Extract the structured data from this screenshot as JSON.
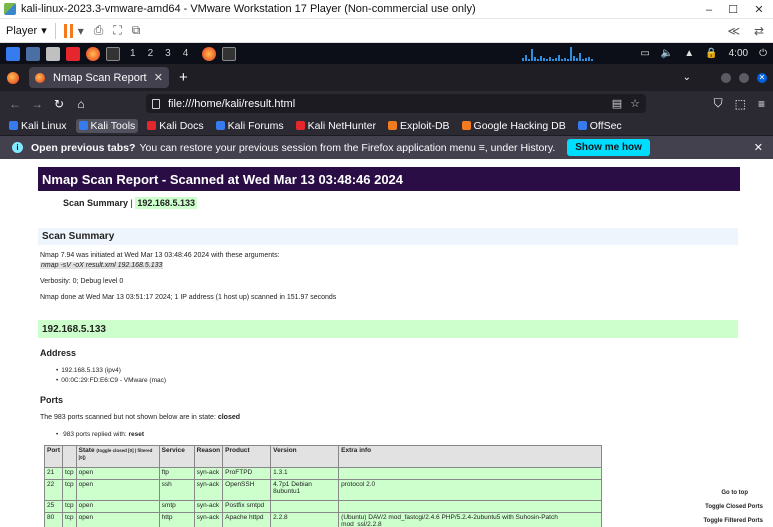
{
  "vmware": {
    "title": "kali-linux-2023.3-vmware-amd64 - VMware Workstation 17 Player (Non-commercial use only)",
    "minimize": "–",
    "maximize": "☐",
    "close": "✕",
    "player_menu": "Player",
    "right_icons": [
      "≪",
      "⇄"
    ]
  },
  "kali_panel": {
    "workspaces": [
      "1",
      "2",
      "3",
      "4"
    ],
    "clock": "4:00"
  },
  "firefox": {
    "tab_title": "Nmap Scan Report - Scanned",
    "tab_close": "✕",
    "new_tab": "+",
    "url": "file:///home/kali/result.html",
    "bookmarks": [
      "Kali Linux",
      "Kali Tools",
      "Kali Docs",
      "Kali Forums",
      "Kali NetHunter",
      "Exploit-DB",
      "Google Hacking DB",
      "OffSec"
    ],
    "bookmark_colors": [
      "#367bf0",
      "#367bf0",
      "#e5272d",
      "#367bf0",
      "#e5272d",
      "#f27b1f",
      "#f27b1f",
      "#367bf0"
    ],
    "notification": {
      "bold": "Open previous tabs?",
      "text": "You can restore your previous session from the Firefox application menu ≡, under History.",
      "button": "Show me how",
      "close": "✕"
    }
  },
  "report": {
    "title": "Nmap Scan Report - Scanned at Wed Mar 13 03:48:46 2024",
    "scan_summary_label": "Scan Summary",
    "scan_summary_sep": "|",
    "scan_summary_ip": "192.168.5.133",
    "section_scan_summary": "Scan Summary",
    "initiated": "Nmap 7.94 was initiated at Wed Mar 13 03:48:46 2024 with these arguments:",
    "command": "nmap -sV -oX result.xml 192.168.5.133",
    "verbosity": "Verbosity: 0; Debug level 0",
    "done": "Nmap done at Wed Mar 13 03:51:17 2024; 1 IP address (1 host up) scanned in 151.97 seconds",
    "host": "192.168.5.133",
    "address_hdr": "Address",
    "addresses": [
      "192.168.5.133 (ipv4)",
      "00:0C:29:FD:E6:C9 - VMware (mac)"
    ],
    "ports_hdr": "Ports",
    "ports_note_prefix": "The 983 ports scanned but not shown below are in state:",
    "ports_note_state": "closed",
    "ports_bullet_prefix": "983 ports replied with:",
    "ports_bullet_reason": "reset",
    "table": {
      "headers": [
        "Port",
        "",
        "State",
        "Service",
        "Reason",
        "Product",
        "Version",
        "Extra info"
      ],
      "state_note": "(toggle closed [0] | filtered [0])",
      "rows": [
        [
          "21",
          "tcp",
          "open",
          "ftp",
          "syn-ack",
          "ProFTPD",
          "1.3.1",
          ""
        ],
        [
          "22",
          "tcp",
          "open",
          "ssh",
          "syn-ack",
          "OpenSSH",
          "4.7p1 Debian 8ubuntu1",
          "protocol 2.0"
        ],
        [
          "25",
          "tcp",
          "open",
          "smtp",
          "syn-ack",
          "Postfix smtpd",
          "",
          ""
        ],
        [
          "80",
          "tcp",
          "open",
          "http",
          "syn-ack",
          "Apache httpd",
          "2.2.8",
          "(Ubuntu) DAV/2 mod_fastcgi/2.4.6 PHP/5.2.4-2ubuntu5 with Suhosin-Patch mod_ssl/2.2.8"
        ]
      ]
    },
    "side_links": [
      "Go to top",
      "Toggle Closed Ports",
      "Toggle Filtered Ports"
    ]
  }
}
